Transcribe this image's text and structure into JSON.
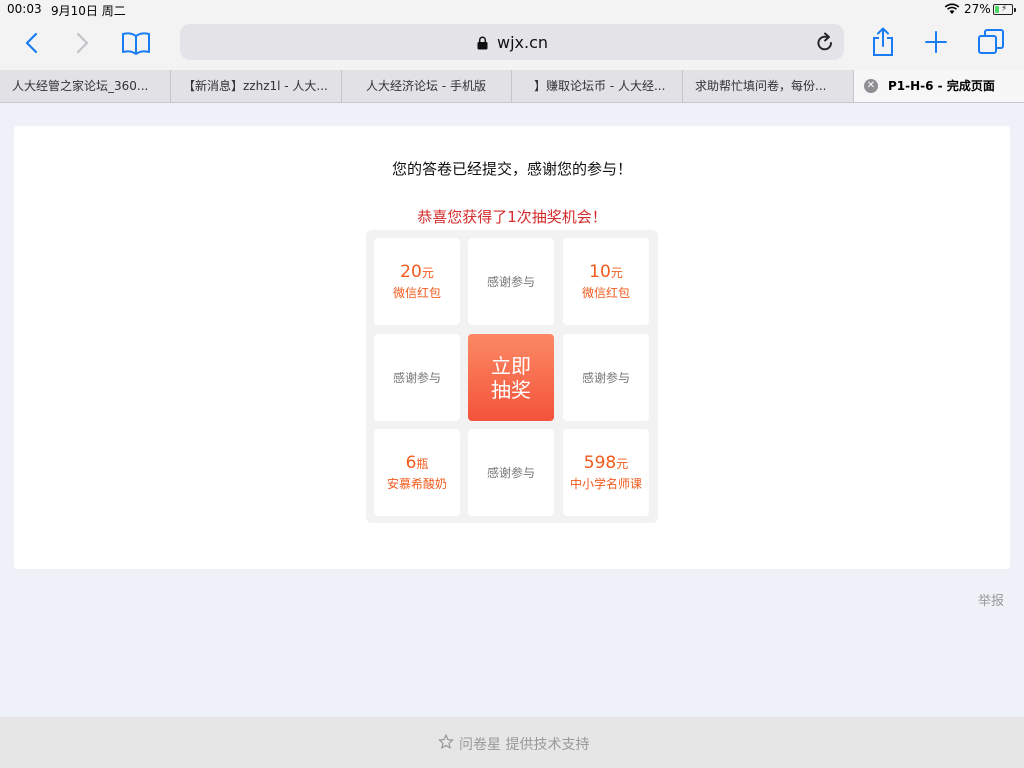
{
  "status_bar": {
    "time": "00:03",
    "date": "9月10日 周二",
    "battery": "27%",
    "battery_level": 0.27
  },
  "browser": {
    "url": "wjx.cn",
    "icons": {
      "back": "chevron-left-icon",
      "forward": "chevron-right-icon",
      "bookmarks": "book-icon",
      "share": "share-icon",
      "new_tab": "plus-icon",
      "tabs": "tabs-icon",
      "reload": "reload-icon",
      "lock": "lock-icon"
    },
    "tabs": [
      {
        "label": "人大经管之家论坛_360..."
      },
      {
        "label": "【新消息】zzhz1l - 人大..."
      },
      {
        "label": "人大经济论坛 - 手机版"
      },
      {
        "label": "】赚取论坛币 - 人大经..."
      },
      {
        "label": "求助帮忙填问卷，每份..."
      },
      {
        "label": "P1-H-6 - 完成页面",
        "active": true
      }
    ]
  },
  "page": {
    "thanks_message": "您的答卷已经提交，感谢您的参与！",
    "lottery_message": "恭喜您获得了1次抽奖机会！",
    "prizes": [
      {
        "amount": "20",
        "unit": "元",
        "desc": "微信红包"
      },
      {
        "none": "感谢参与"
      },
      {
        "amount": "10",
        "unit": "元",
        "desc": "微信红包"
      },
      {
        "none": "感谢参与"
      },
      {
        "none": "感谢参与"
      },
      {
        "amount": "6",
        "unit": "瓶",
        "desc": "安慕希酸奶"
      },
      {
        "none": "感谢参与"
      },
      {
        "amount": "598",
        "unit": "元",
        "desc": "中小学名师课"
      }
    ],
    "draw_button": {
      "line1": "立即",
      "line2": "抽奖"
    },
    "report_link": "举报",
    "footer_text": "问卷星 提供技术支持"
  },
  "colors": {
    "accent": "#f25a1c",
    "congrats": "#d42b2b",
    "draw_gradient_top": "#fb8a64",
    "draw_gradient_bottom": "#f4533b",
    "ios_blue": "#1a7cf5"
  }
}
